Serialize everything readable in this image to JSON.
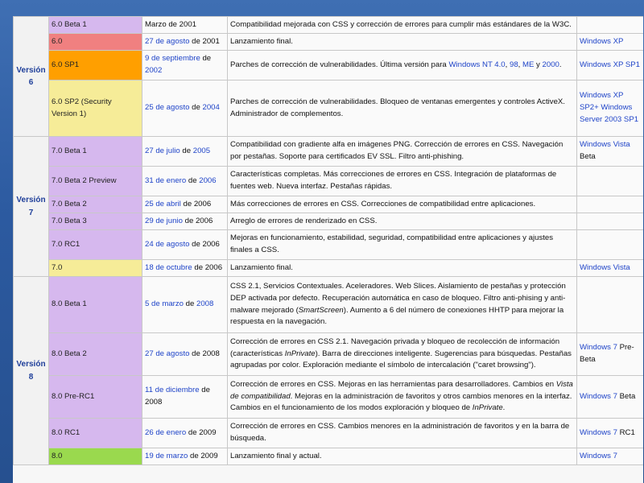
{
  "colors": {
    "beta": "#d6b8ee",
    "final_old": "#f08080",
    "sp": "#ff9f00",
    "final": "#f6ec98",
    "current": "#9ad94e",
    "link": "#1f44c8"
  },
  "groups": {
    "v6": "Versión 6",
    "v7": "Versión 7",
    "v8": "Versión 8"
  },
  "rows": [
    {
      "version": "6.0 Beta 1",
      "date_a": "Marzo de 2001",
      "date_a_link": false,
      "date_mid": "",
      "date_b": "",
      "desc": [
        "Compatibilidad mejorada con CSS y corrección de errores para cumplir más estándares de la W3C."
      ],
      "os": ""
    },
    {
      "version": "6.0",
      "date_a": "27 de agosto",
      "date_a_link": true,
      "date_mid": " de 2001",
      "date_b": "",
      "desc": [
        "Lanzamiento final."
      ],
      "os": "Windows XP"
    },
    {
      "version": "6.0 SP1",
      "date_a": "9 de septiembre",
      "date_a_link": true,
      "date_mid": " de ",
      "date_b": "2002",
      "desc": [
        "Parches de corrección de vulnerabilidades. Última versión para ",
        "Windows NT 4.0",
        ", ",
        "98",
        ", ",
        "ME",
        " y ",
        "2000",
        "."
      ],
      "os": "Windows XP SP1"
    },
    {
      "version": "6.0 SP2 (Security Version 1)",
      "date_a": "25 de agosto",
      "date_a_link": true,
      "date_mid": " de ",
      "date_b": "2004",
      "desc": [
        "Parches de corrección de vulnerabilidades. Bloqueo de ventanas emergentes y controles ActiveX. Administrador de complementos."
      ],
      "os": "Windows XP SP2+ Windows Server 2003 SP1"
    },
    {
      "version": "7.0 Beta 1",
      "date_a": "27 de julio",
      "date_a_link": true,
      "date_mid": " de ",
      "date_b": "2005",
      "desc": [
        "Compatibilidad con gradiente alfa en imágenes PNG. Corrección de errores en CSS. Navegación por pestañas. Soporte para certificados EV SSL. Filtro anti-phishing."
      ],
      "os": "Windows Vista",
      "os_suffix": " Beta"
    },
    {
      "version": "7.0 Beta 2 Preview",
      "date_a": "31 de enero",
      "date_a_link": true,
      "date_mid": " de ",
      "date_b": "2006",
      "desc": [
        "Características completas. Más correcciones de errores en CSS. Integración de plataformas de fuentes web. Nueva interfaz. Pestañas rápidas."
      ],
      "os": ""
    },
    {
      "version": "7.0 Beta 2",
      "date_a": "25 de abril",
      "date_a_link": true,
      "date_mid": " de 2006",
      "date_b": "",
      "desc": [
        "Más correcciones de errores en CSS. Correcciones de compatibilidad entre aplicaciones."
      ],
      "os": ""
    },
    {
      "version": "7.0 Beta 3",
      "date_a": "29 de junio",
      "date_a_link": true,
      "date_mid": " de 2006",
      "date_b": "",
      "desc": [
        "Arreglo de errores de renderizado en CSS."
      ],
      "os": ""
    },
    {
      "version": "7.0 RC1",
      "date_a": "24 de agosto",
      "date_a_link": true,
      "date_mid": " de 2006",
      "date_b": "",
      "desc": [
        "Mejoras en funcionamiento, estabilidad, seguridad, compatibilidad entre aplicaciones y ajustes finales a CSS."
      ],
      "os": ""
    },
    {
      "version": "7.0",
      "date_a": "18 de octubre",
      "date_a_link": true,
      "date_mid": " de 2006",
      "date_b": "",
      "desc": [
        "Lanzamiento final."
      ],
      "os": "Windows Vista"
    },
    {
      "version": "8.0 Beta 1",
      "date_a": "5 de marzo",
      "date_a_link": true,
      "date_mid": " de ",
      "date_b": "2008",
      "desc_parts": {
        "p1": "CSS 2.1, Servicios Contextuales. Aceleradores. Web Slices. Aislamiento de pestañas y protección DEP activada por defecto. Recuperación automática en caso de bloqueo. Filtro anti-phising y anti-malware mejorado (",
        "em": "SmartScreen",
        "p2": "). Aumento a 6 del número de conexiones HHTP para mejorar la respuesta en la navegación."
      },
      "os": ""
    },
    {
      "version": "8.0 Beta 2",
      "date_a": "27 de agosto",
      "date_a_link": true,
      "date_mid": " de 2008",
      "date_b": "",
      "desc_parts": {
        "p1": "Corrección de errores en CSS 2.1. Navegación privada y bloqueo de recolección de información (características ",
        "em": "InPrivate",
        "p2": "). Barra de direcciones inteligente. Sugerencias para búsquedas. Pestañas agrupadas por color. Exploración mediante el símbolo de intercalación (\"caret browsing\")."
      },
      "os": "Windows 7",
      "os_suffix": " Pre-Beta"
    },
    {
      "version": "8.0 Pre-RC1",
      "date_a": "11 de diciembre",
      "date_a_link": true,
      "date_mid": " de 2008",
      "date_b": "",
      "desc_parts3": {
        "p1": "Corrección de errores en CSS. Mejoras en las herramientas para desarrolladores. Cambios en ",
        "em1": "Vista de compatibilidad",
        "p2": ". Mejoras en la administración de favoritos y otros cambios menores en la interfaz. Cambios en el funcionamiento de los modos exploración y bloqueo de ",
        "em2": "InPrivate",
        "p3": "."
      },
      "os": "Windows 7",
      "os_suffix": " Beta"
    },
    {
      "version": "8.0 RC1",
      "date_a": "26 de enero",
      "date_a_link": true,
      "date_mid": " de 2009",
      "date_b": "",
      "desc": [
        "Corrección de errores en CSS. Cambios menores en la administración de favoritos y en la barra de búsqueda."
      ],
      "os": "Windows 7",
      "os_suffix": " RC1"
    },
    {
      "version": "8.0",
      "date_a": "19 de marzo",
      "date_a_link": true,
      "date_mid": " de 2009",
      "date_b": "",
      "desc": [
        "Lanzamiento final y actual."
      ],
      "os": "Windows 7"
    }
  ]
}
